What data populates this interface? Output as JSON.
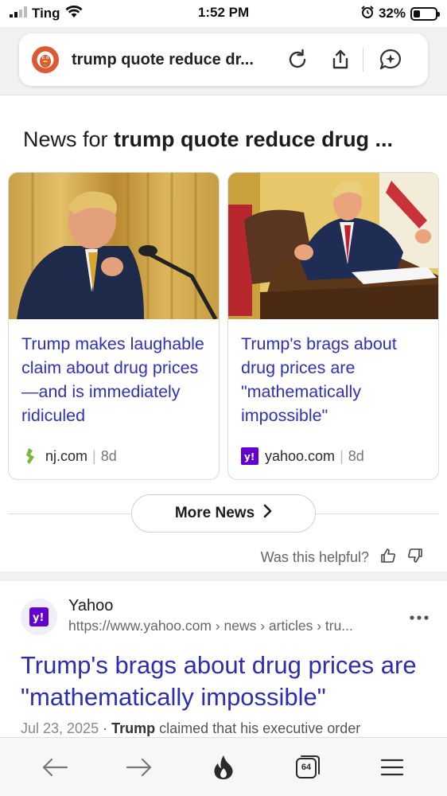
{
  "status": {
    "carrier": "Ting",
    "time": "1:52 PM",
    "battery": "32%",
    "battery_level": 0.32
  },
  "address_bar": {
    "query": "trump quote reduce dr..."
  },
  "news": {
    "heading_prefix": "News for",
    "heading_query": "trump quote reduce drug ...",
    "cards": [
      {
        "title": "Trump makes laughable claim about drug prices—and is immediately ridiculed",
        "source": "nj.com",
        "age": "8d"
      },
      {
        "title": "Trump's brags about drug prices are \"mathematically impossible\"",
        "source": "yahoo.com",
        "age": "8d"
      }
    ],
    "more_label": "More News",
    "helpful_label": "Was this helpful?"
  },
  "result": {
    "site_name": "Yahoo",
    "url": "https://www.yahoo.com › news › articles › tru...",
    "title": "Trump's brags about drug prices are \"mathematically impossible\"",
    "date": "Jul 23, 2025",
    "snippet_bold": "Trump",
    "snippet_rest": " claimed that his executive order"
  },
  "toolbar": {
    "tab_count": "64"
  },
  "colors": {
    "link": "#3030b8",
    "ddg_orange": "#de5833",
    "yahoo_purple": "#6001d2"
  }
}
